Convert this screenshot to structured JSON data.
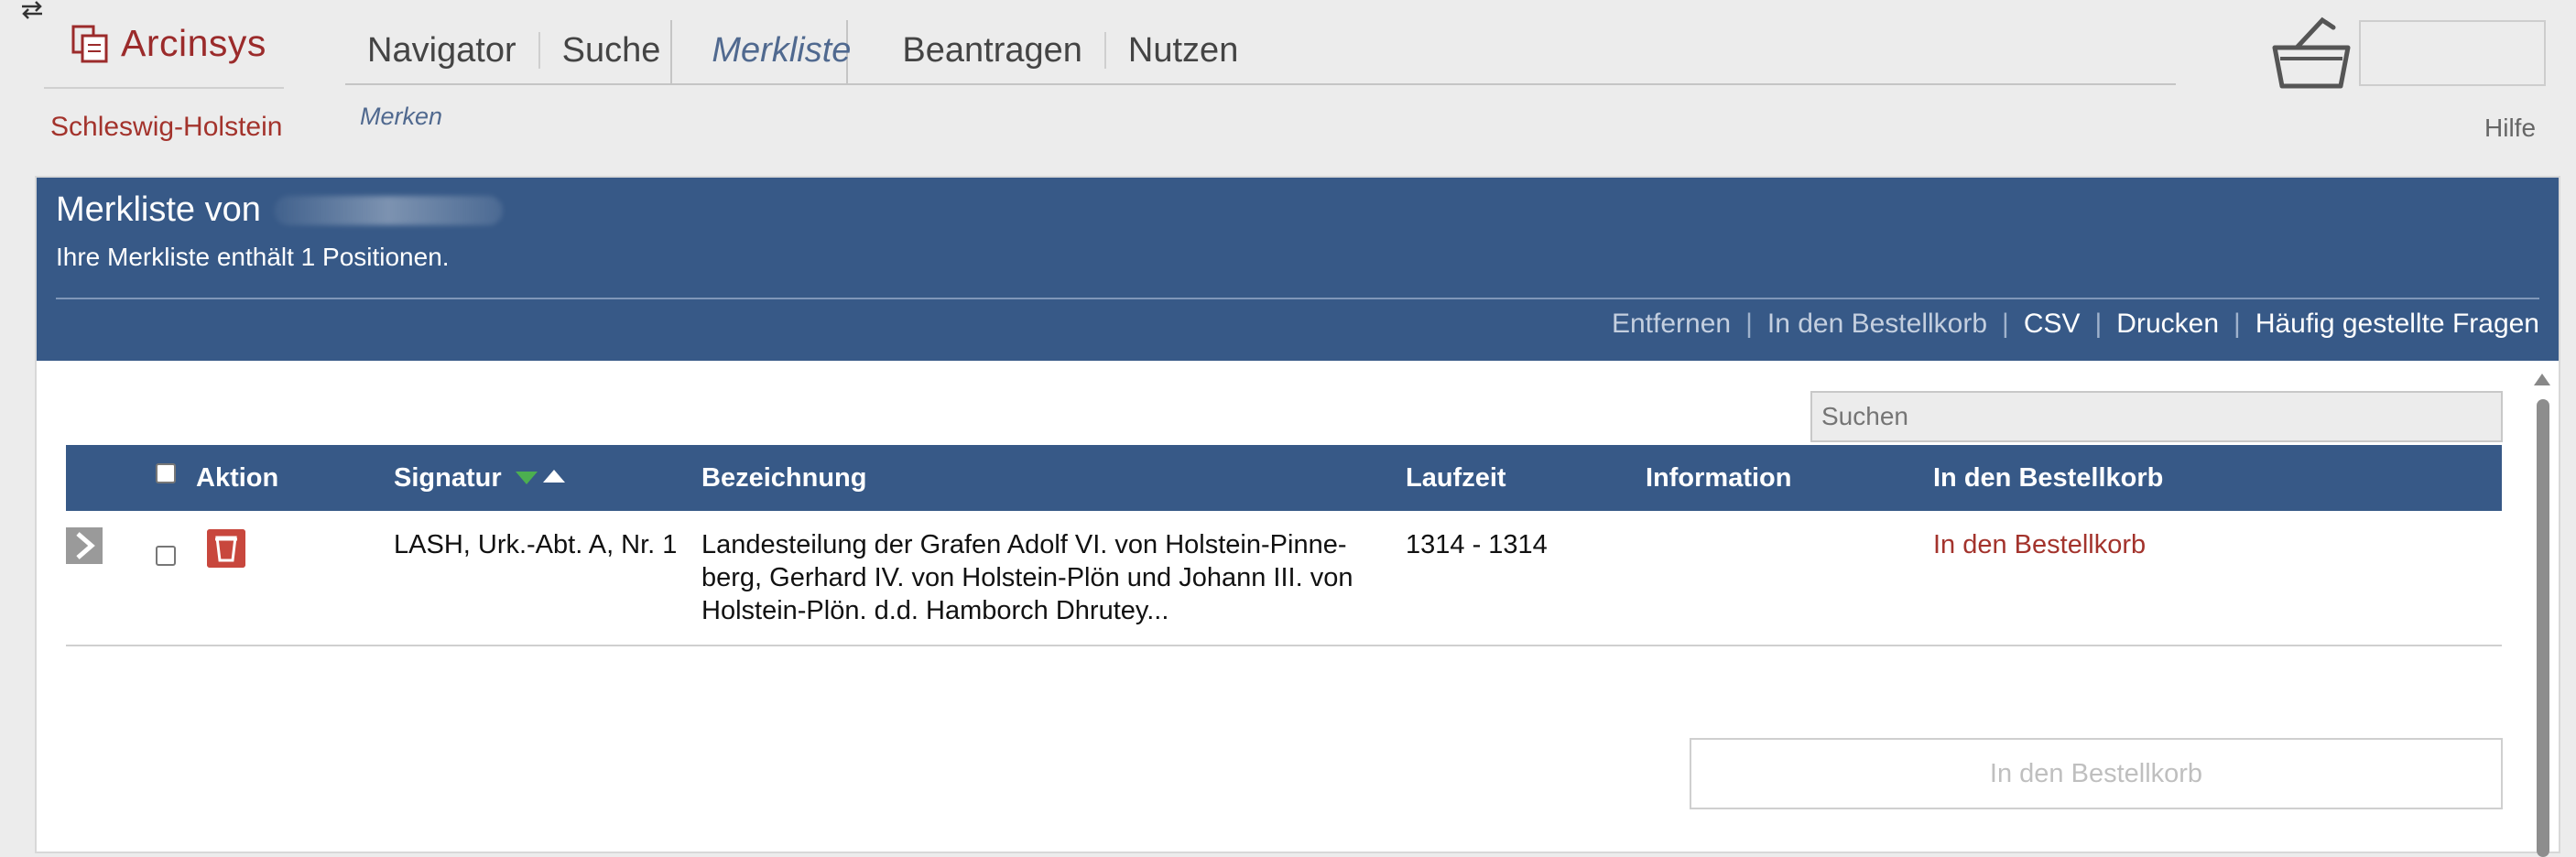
{
  "header": {
    "app_name": "Arcinsys",
    "region": "Schleswig-Holstein",
    "nav": [
      "Navigator",
      "Suche",
      "Merkliste",
      "Beantragen",
      "Nutzen"
    ],
    "active_nav": "Merkliste",
    "subnav": "Merken",
    "help": "Hilfe"
  },
  "panel": {
    "title": "Merkliste von",
    "subtitle": "Ihre Merkliste enthält 1 Positionen.",
    "actions": [
      {
        "label": "Entfernen",
        "enabled": false
      },
      {
        "label": "In den Bestellkorb",
        "enabled": false
      },
      {
        "label": "CSV",
        "enabled": true
      },
      {
        "label": "Drucken",
        "enabled": true
      },
      {
        "label": "Häufig gestellte Fragen",
        "enabled": true
      }
    ]
  },
  "search": {
    "placeholder": "Suchen"
  },
  "table": {
    "columns": [
      "Aktion",
      "Signatur",
      "Bezeichnung",
      "Laufzeit",
      "Information",
      "In den Bestellkorb"
    ],
    "rows": [
      {
        "signatur": "LASH, Urk.-Abt. A, Nr. 1",
        "bezeichnung_lines": [
          "Landesteilung der Grafen Adolf VI. von Holstein-Pinne-",
          "berg, Gerhard IV. von Holstein-Plön und Johann III. von",
          "Holstein-Plön. d.d. Hamborch Dhrutey..."
        ],
        "laufzeit": "1314 - 1314",
        "information": "",
        "bestellkorb": "In den Bestellkorb"
      }
    ]
  },
  "bottom_button": "In den Bestellkorb",
  "colors": {
    "brand": "#9b2b2b",
    "header_blue": "#375987",
    "link_red": "#a3332c"
  }
}
